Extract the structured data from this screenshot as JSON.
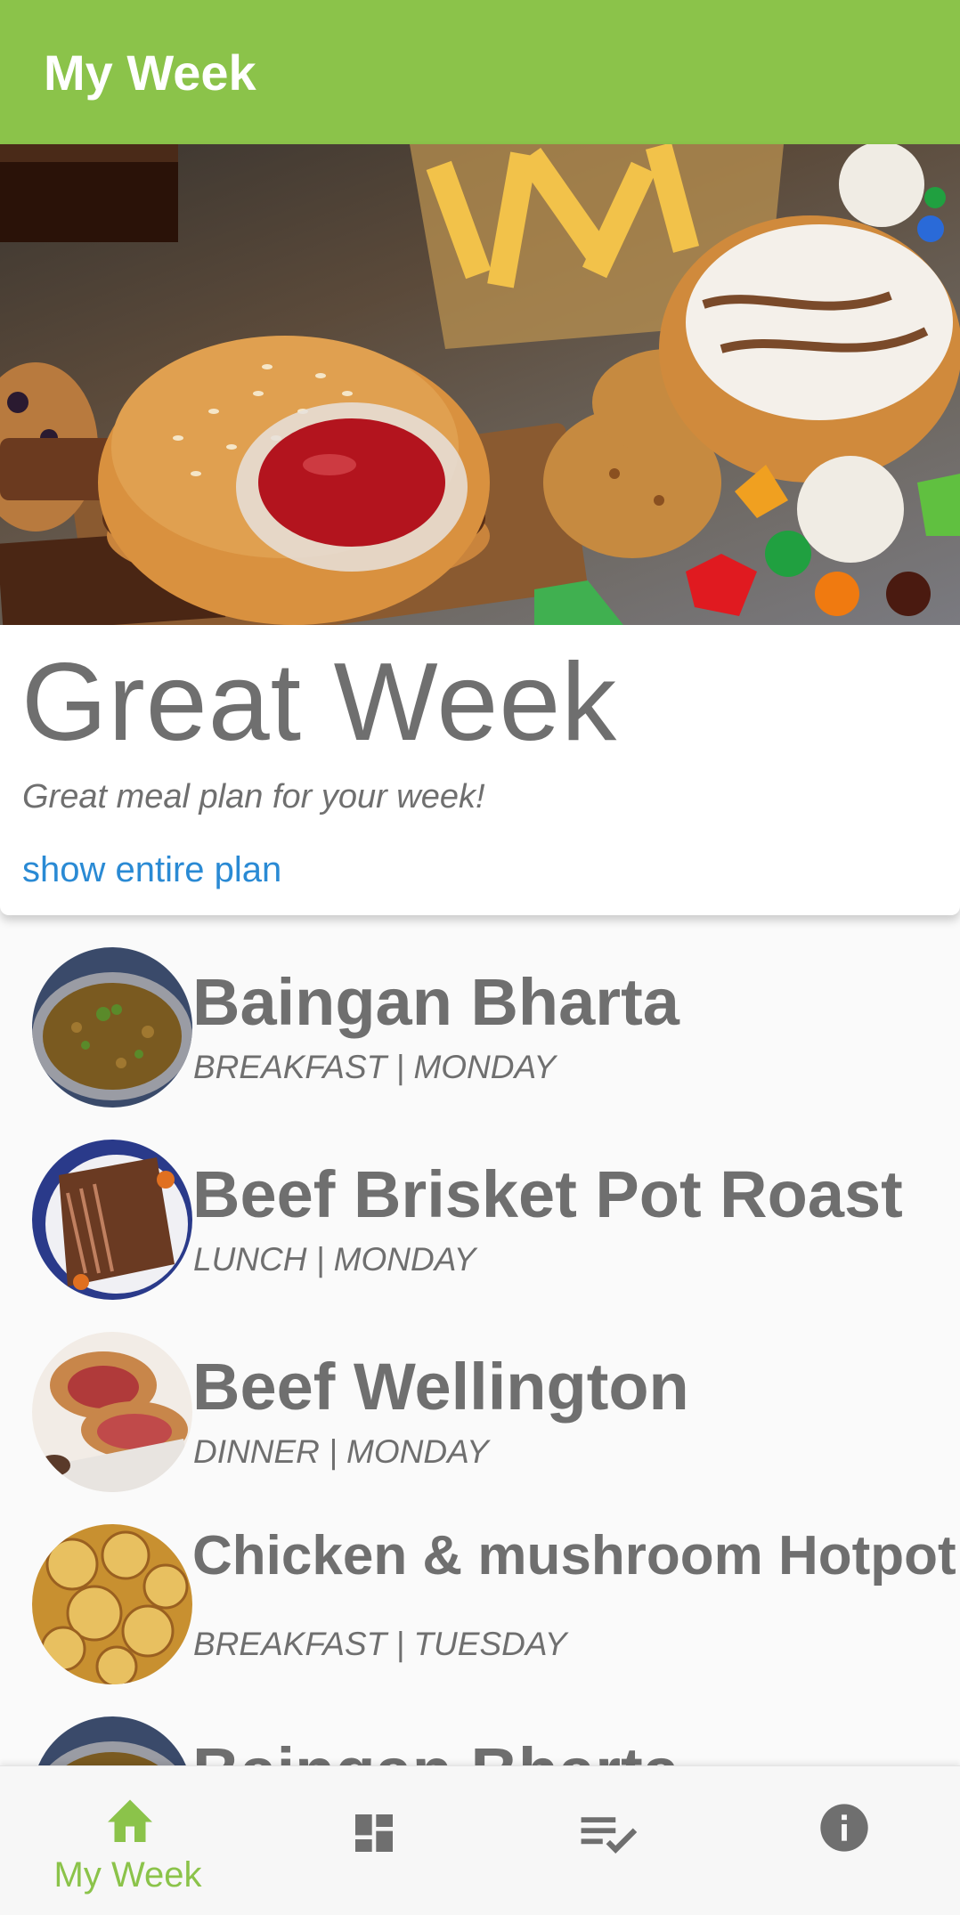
{
  "app_bar": {
    "title": "My Week"
  },
  "plan_card": {
    "title": "Great Week",
    "subtitle": "Great meal plan for your week!",
    "link": "show entire plan"
  },
  "meals": [
    {
      "name": "Baingan Bharta",
      "meal": "BREAKFAST",
      "day": "MONDAY",
      "separator": "|"
    },
    {
      "name": "Beef Brisket Pot Roast",
      "meal": "LUNCH",
      "day": "MONDAY",
      "separator": "|"
    },
    {
      "name": "Beef Wellington",
      "meal": "DINNER",
      "day": "MONDAY",
      "separator": "|"
    },
    {
      "name": "Chicken & mushroom Hotpot",
      "meal": "BREAKFAST",
      "day": "TUESDAY",
      "separator": "|"
    },
    {
      "name": "Baingan Bharta"
    }
  ],
  "bottom_nav": {
    "items": [
      {
        "icon": "home-icon",
        "label": "My Week",
        "active": true
      },
      {
        "icon": "dashboard-icon"
      },
      {
        "icon": "playlist-check-icon"
      },
      {
        "icon": "info-icon"
      }
    ],
    "active_color": "#8bc34a",
    "inactive_color": "#6f6f6f"
  },
  "colors": {
    "primary": "#8bc34a",
    "link": "#2a8ad4",
    "text": "#6f6f6f"
  }
}
